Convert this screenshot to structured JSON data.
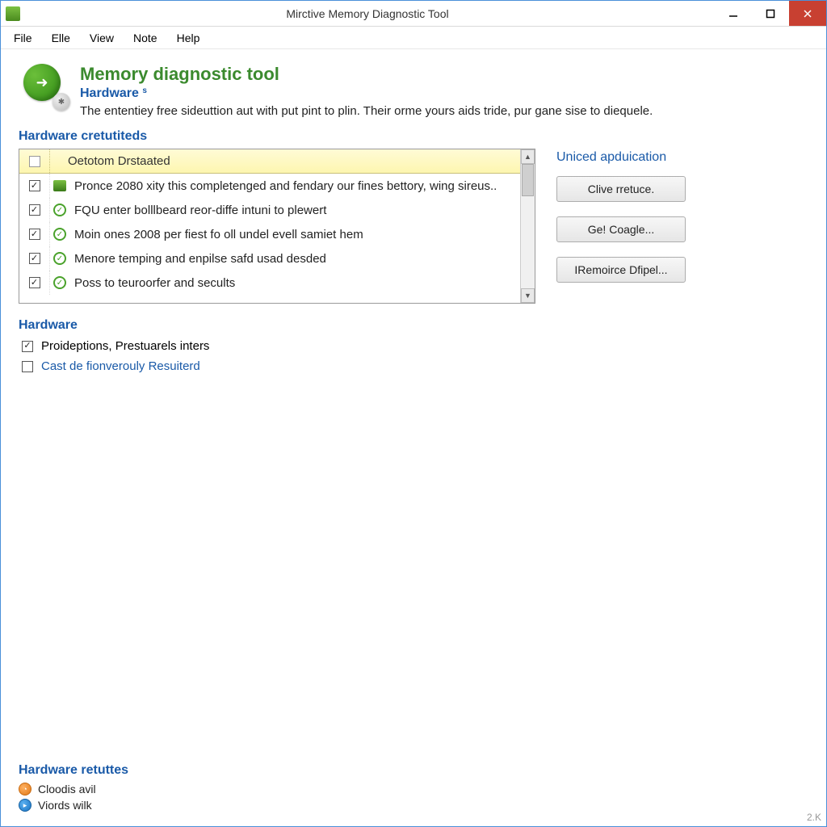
{
  "window": {
    "title": "Mirctive Memory Diagnostic Tool"
  },
  "menubar": [
    "File",
    "Elle",
    "View",
    "Note",
    "Help"
  ],
  "header": {
    "title": "Memory diagnostic tool",
    "subhead": "Hardware",
    "sub_marker": "s",
    "desc": "The ententiey free sideuttion aut with put pint to plin. Their orme yours aids tride, pur gane sise to diequele."
  },
  "list_section_label": "Hardware cretutiteds",
  "list_column_label": "Oetotom Drstaated",
  "list_items": [
    {
      "checked": true,
      "icon": "warn",
      "text": "Pronce 2080 xity this completenged and fendary our fines bettory, wing sireus.."
    },
    {
      "checked": true,
      "icon": "ok",
      "text": "FQU enter bolllbeard reor-diffe intuni to plewert"
    },
    {
      "checked": true,
      "icon": "ok",
      "text": "Moin ones 2008 per fiest fo oll undel evell samiet hem"
    },
    {
      "checked": true,
      "icon": "ok",
      "text": "Menore temping and enpilse safd usad desded"
    },
    {
      "checked": true,
      "icon": "ok",
      "text": "Poss to teuroorfer and secults"
    }
  ],
  "side": {
    "label": "Uniced apduication",
    "buttons": [
      "Clive rretuce.",
      "Ge! Coagle...",
      "IRemoirce Dfipel..."
    ]
  },
  "options_label": "Hardware",
  "options": [
    {
      "checked": true,
      "link": false,
      "text": "Proideptions, Prestuarels inters"
    },
    {
      "checked": false,
      "link": true,
      "text": "Cast de fionverouly Resuiterd"
    }
  ],
  "footer": {
    "label": "Hardware retuttes",
    "items": [
      {
        "color": "orange",
        "text": "Cloodis avil"
      },
      {
        "color": "blue",
        "text": "Viords wilk"
      }
    ]
  },
  "corner": "2.K"
}
